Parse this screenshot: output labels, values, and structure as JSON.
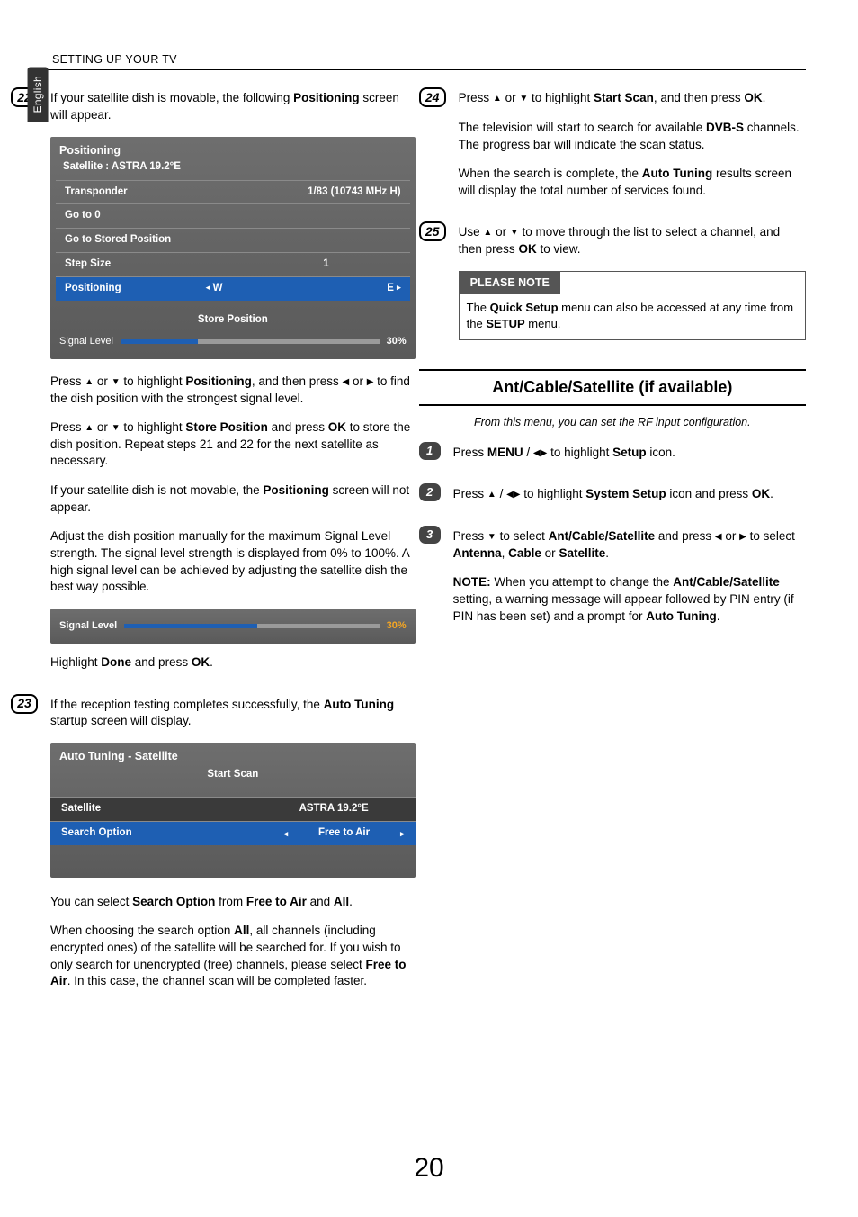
{
  "header": {
    "running_head": "SETTING UP YOUR TV",
    "language_tab": "English"
  },
  "glyphs": {
    "up": "▲",
    "down": "▼",
    "left": "◀",
    "right": "▶",
    "left_sm": "◂",
    "right_sm": "▸"
  },
  "left": {
    "step22": {
      "num": "22",
      "intro_a": "If your satellite dish is movable, the following ",
      "intro_b": "Positioning",
      "intro_c": " screen will appear.",
      "osd": {
        "title": "Positioning",
        "subtitle": "Satellite : ASTRA 19.2°E",
        "rows": {
          "transponder": {
            "label": "Transponder",
            "value": "1/83 (10743 MHz  H)"
          },
          "goto0": {
            "label": "Go to 0"
          },
          "gostored": {
            "label": "Go to Stored Position"
          },
          "stepsize": {
            "label": "Step Size",
            "value": "1"
          },
          "positioning": {
            "label": "Positioning",
            "w": "W",
            "e": "E"
          }
        },
        "store": "Store Position",
        "signal": {
          "label": "Signal Level",
          "pct_text": "30%",
          "pct": 30
        }
      },
      "p1_a": "Press ",
      "p1_b": " or ",
      "p1_c": " to highlight ",
      "p1_pos": "Positioning",
      "p1_d": ", and then press ",
      "p1_e": " or ",
      "p1_f": " to find the dish position with the strongest signal level.",
      "p2_a": "Press ",
      "p2_b": " or ",
      "p2_c": " to highlight ",
      "p2_store": "Store Position",
      "p2_d": " and press ",
      "p2_ok": "OK",
      "p2_e": " to store the dish position. Repeat steps 21 and 22 for the next satellite as necessary.",
      "p3_a": "If your satellite dish is not movable, the ",
      "p3_pos": "Positioning",
      "p3_b": " screen will not appear.",
      "p4": "Adjust the dish position manually for the maximum Signal Level strength. The signal level strength is displayed from 0% to 100%. A high signal level can be achieved by adjusting the satellite dish the best way possible.",
      "sig2": {
        "label": "Signal Level",
        "pct_text": "30%",
        "pct": 52
      },
      "p5_a": "Highlight ",
      "p5_done": "Done",
      "p5_b": " and press ",
      "p5_ok": "OK",
      "p5_c": "."
    },
    "step23": {
      "num": "23",
      "p1_a": "If the reception testing completes successfully, the ",
      "p1_at": "Auto Tuning",
      "p1_b": " startup screen will display.",
      "panel": {
        "title": "Auto Tuning - Satellite",
        "start": "Start Scan",
        "rows": {
          "satellite": {
            "label": "Satellite",
            "value": "ASTRA 19.2°E"
          },
          "search": {
            "label": "Search Option",
            "value": "Free to Air"
          }
        }
      },
      "p2_a": "You can select ",
      "p2_so": "Search Option",
      "p2_b": " from ",
      "p2_fta": "Free to Air",
      "p2_c": " and ",
      "p2_all": "All",
      "p2_d": ".",
      "p3_a": "When choosing the search option ",
      "p3_all": "All",
      "p3_b": ", all channels (including encrypted ones) of the satellite will be searched for. If you wish to only search for unencrypted (free) channels, please select ",
      "p3_fta": "Free to Air",
      "p3_c": ". In this case, the channel scan will be completed faster."
    }
  },
  "right": {
    "step24": {
      "num": "24",
      "p1_a": "Press ",
      "p1_b": " or ",
      "p1_c": " to highlight ",
      "p1_ss": "Start Scan",
      "p1_d": ", and then press ",
      "p1_ok": "OK",
      "p1_e": ".",
      "p2_a": "The television will start to search for available ",
      "p2_dvbs": "DVB-S",
      "p2_b": " channels. The progress bar will indicate the scan status.",
      "p3_a": "When the search is complete, the ",
      "p3_at": "Auto Tuning",
      "p3_b": " results screen will display the total number of services found."
    },
    "step25": {
      "num": "25",
      "p1_a": "Use ",
      "p1_b": " or ",
      "p1_c": " to move through the list to select a channel, and then press ",
      "p1_ok": "OK",
      "p1_d": " to view."
    },
    "note": {
      "head": "PLEASE NOTE",
      "a": "The ",
      "qs": "Quick Setup",
      "b": " menu can also be accessed at any time from the ",
      "setup": "SETUP",
      "c": " menu."
    },
    "section": {
      "title": "Ant/Cable/Satellite (if available)",
      "lead": "From this menu, you can set the RF input configuration."
    },
    "s1": {
      "num": "1",
      "a": "Press ",
      "menu": "MENU",
      "b": " / ",
      "c": " to highlight ",
      "setup": "Setup",
      "d": " icon."
    },
    "s2": {
      "num": "2",
      "a": "Press ",
      "b": " / ",
      "c": " to highlight ",
      "ss": "System Setup",
      "d": " icon and press ",
      "ok": "OK",
      "e": "."
    },
    "s3": {
      "num": "3",
      "a": "Press ",
      "b": " to select ",
      "acs": "Ant/Cable/Satellite",
      "c": " and press ",
      "d": " or ",
      "e": " to select ",
      "ant": "Antenna",
      "comma1": ", ",
      "cable": "Cable",
      "or": " or ",
      "sat": "Satellite",
      "f": ".",
      "note_a": "NOTE:",
      "note_b": " When you attempt to change the ",
      "note_acs": "Ant/Cable/Satellite",
      "note_c": " setting, a warning message will appear followed by PIN entry (if PIN has been set) and a prompt for ",
      "note_at": "Auto Tuning",
      "note_d": "."
    }
  },
  "page_number": "20"
}
